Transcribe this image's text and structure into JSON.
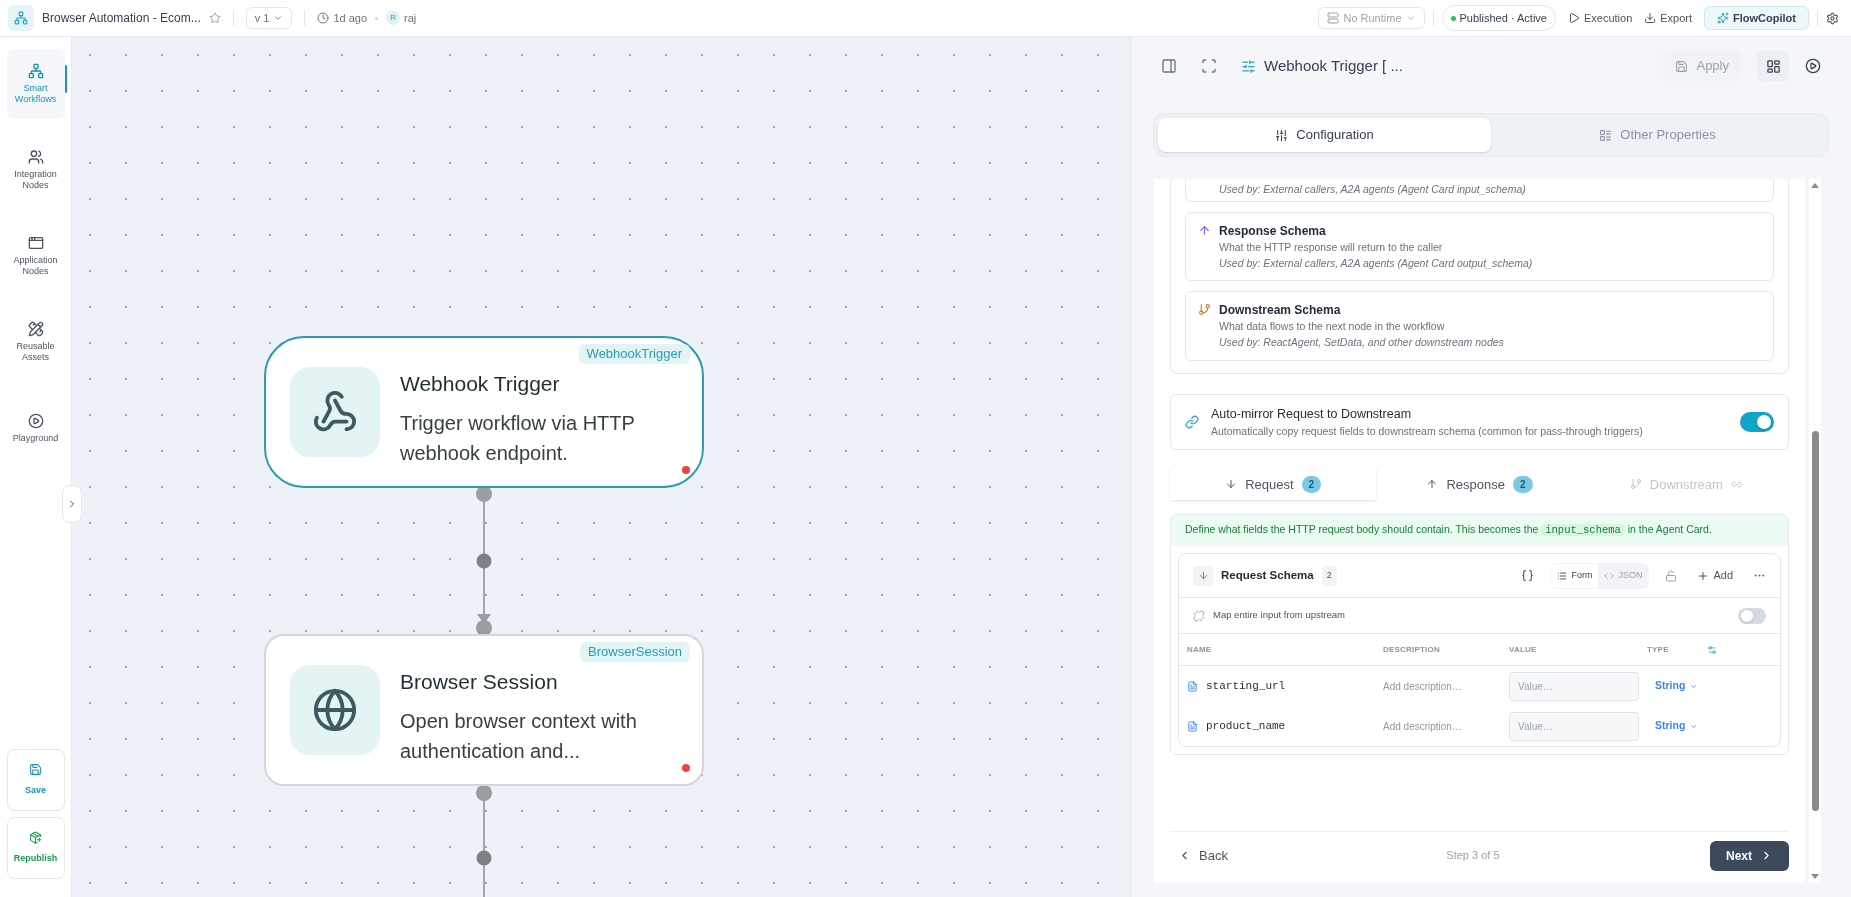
{
  "topbar": {
    "workflow_name": "Browser Automation - Ecom...",
    "version": "v 1",
    "updated": "1d ago",
    "user_initial": "R",
    "user": "raj",
    "runtime": "No Runtime",
    "status": "Published · Active",
    "actions": [
      {
        "label": "Execution",
        "kind": "execution"
      },
      {
        "label": "Export",
        "kind": "export"
      }
    ],
    "copilot": "FlowCopilot"
  },
  "sidebar": {
    "items": [
      {
        "label": "Smart Workflows",
        "kind": "workflows",
        "selected": true
      },
      {
        "label": "Integration Nodes",
        "kind": "integration",
        "selected": false
      },
      {
        "label": "Application Nodes",
        "kind": "application",
        "selected": false
      },
      {
        "label": "Reusable Assets",
        "kind": "assets",
        "selected": false
      },
      {
        "label": "Playground",
        "kind": "playground",
        "selected": false
      }
    ],
    "bottom_actions": [
      {
        "label": "Save",
        "kind": "save"
      },
      {
        "label": "Republish",
        "kind": "republish"
      }
    ]
  },
  "canvas": {
    "nodes": [
      {
        "kind": "webhook",
        "tag": "WebhookTrigger",
        "title": "Webhook Trigger",
        "description": "Trigger workflow via HTTP webhook endpoint.",
        "selected": true
      },
      {
        "kind": "browser",
        "tag": "BrowserSession",
        "title": "Browser Session",
        "description": "Open browser context with authentication and...",
        "selected": false
      }
    ]
  },
  "panel": {
    "title": "Webhook Trigger [ ...",
    "apply": "Apply",
    "tabs": [
      {
        "label": "Configuration",
        "kind": "configuration",
        "selected": true
      },
      {
        "label": "Other Properties",
        "kind": "properties",
        "selected": false
      }
    ],
    "schema_cards": [
      {
        "used_by": "Used by: External callers, A2A agents (Agent Card input_schema)"
      },
      {
        "kind": "response",
        "title": "Response Schema",
        "description": "What the HTTP response will return to the caller",
        "used_by": "Used by: External callers, A2A agents (Agent Card output_schema)"
      },
      {
        "kind": "downstream",
        "title": "Downstream Schema",
        "description": "What data flows to the next node in the workflow",
        "used_by": "Used by: ReactAgent, SetData, and other downstream nodes"
      }
    ],
    "auto_mirror": {
      "title": "Auto-mirror Request to Downstream",
      "description": "Automatically copy request fields to downstream schema (common for pass-through triggers)",
      "on": true
    },
    "schema_tabs": [
      {
        "kind": "request",
        "label": "Request",
        "count": "2",
        "selected": true,
        "disabled": false
      },
      {
        "kind": "response",
        "label": "Response",
        "count": "2",
        "selected": false,
        "disabled": false
      },
      {
        "kind": "downstream",
        "label": "Downstream",
        "selected": false,
        "disabled": true
      }
    ],
    "info": {
      "before": "Define what fields the HTTP request body should contain. This becomes the",
      "code": "input_schema",
      "after": "in the Agent Card."
    },
    "request_schema": {
      "title": "Request Schema",
      "count": "2",
      "views": [
        {
          "label": "Form",
          "kind": "form",
          "selected": true
        },
        {
          "label": "JSON",
          "kind": "json",
          "selected": false
        }
      ],
      "add": "Add",
      "map_upstream": {
        "label": "Map entire input from upstream",
        "on": false
      },
      "columns": [
        "NAME",
        "DESCRIPTION",
        "VALUE",
        "TYPE"
      ],
      "fields": [
        {
          "name": "starting_url",
          "description_placeholder": "Add description…",
          "value_placeholder": "Value…",
          "type": "String"
        },
        {
          "name": "product_name",
          "description_placeholder": "Add description…",
          "value_placeholder": "Value…",
          "type": "String"
        }
      ]
    },
    "footer": {
      "back": "Back",
      "step": "Step 3 of 5",
      "next": "Next"
    }
  }
}
